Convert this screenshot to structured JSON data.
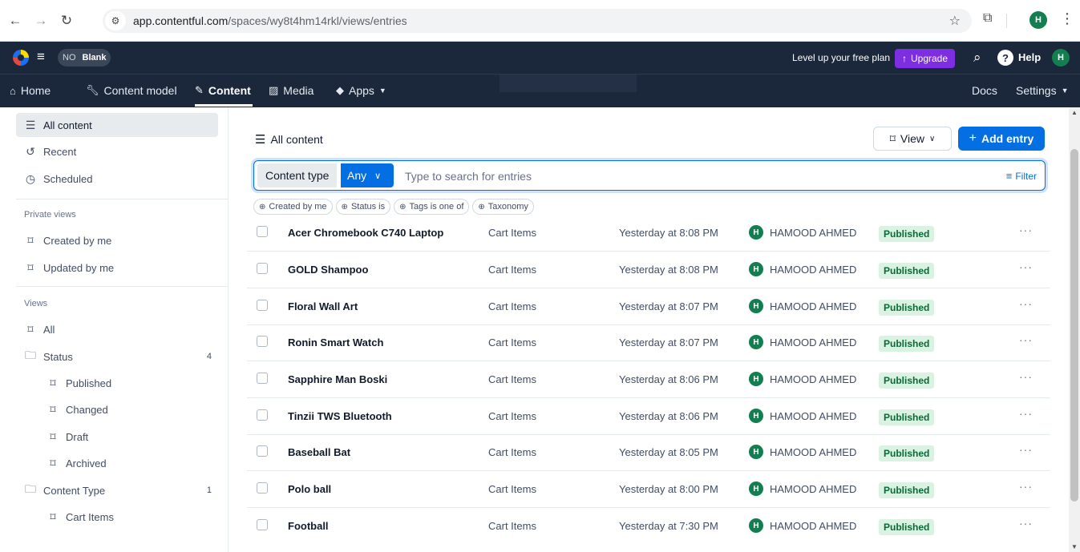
{
  "browser": {
    "url_host": "app.contentful.com",
    "url_path": "/spaces/wy8t4hm14rkl/views/entries",
    "profile_initial": "H"
  },
  "topbar": {
    "org_initials": "NO",
    "space_name": "Blank",
    "level_up": "Level up your free plan",
    "upgrade": "Upgrade",
    "help": "Help",
    "avatar_initial": "H"
  },
  "nav": {
    "home": "Home",
    "content_model": "Content model",
    "content": "Content",
    "media": "Media",
    "apps": "Apps",
    "docs": "Docs",
    "settings": "Settings"
  },
  "sidebar": {
    "all_content": "All content",
    "recent": "Recent",
    "scheduled": "Scheduled",
    "private_views_heading": "Private views",
    "created_by_me": "Created by me",
    "updated_by_me": "Updated by me",
    "views_heading": "Views",
    "all": "All",
    "status": "Status",
    "status_count": "4",
    "published": "Published",
    "changed": "Changed",
    "draft": "Draft",
    "archived": "Archived",
    "content_type": "Content Type",
    "content_type_count": "1",
    "cart_items": "Cart Items"
  },
  "main": {
    "title": "All content",
    "view_button": "View",
    "add_entry": "Add entry",
    "content_type_label": "Content type",
    "content_type_value": "Any",
    "search_placeholder": "Type to search for entries",
    "filter": "Filter",
    "chips": [
      "Created by me",
      "Status is",
      "Tags is one of",
      "Taxonomy"
    ]
  },
  "entries": [
    {
      "name": "Acer Chromebook C740 Laptop",
      "type": "Cart Items",
      "updated": "Yesterday at 8:08 PM",
      "author_initial": "H",
      "author": "HAMOOD AHMED",
      "status": "Published"
    },
    {
      "name": "GOLD Shampoo",
      "type": "Cart Items",
      "updated": "Yesterday at 8:08 PM",
      "author_initial": "H",
      "author": "HAMOOD AHMED",
      "status": "Published"
    },
    {
      "name": "Floral Wall Art",
      "type": "Cart Items",
      "updated": "Yesterday at 8:07 PM",
      "author_initial": "H",
      "author": "HAMOOD AHMED",
      "status": "Published"
    },
    {
      "name": "Ronin Smart Watch",
      "type": "Cart Items",
      "updated": "Yesterday at 8:07 PM",
      "author_initial": "H",
      "author": "HAMOOD AHMED",
      "status": "Published"
    },
    {
      "name": "Sapphire Man Boski",
      "type": "Cart Items",
      "updated": "Yesterday at 8:06 PM",
      "author_initial": "H",
      "author": "HAMOOD AHMED",
      "status": "Published"
    },
    {
      "name": "Tinzii TWS Bluetooth",
      "type": "Cart Items",
      "updated": "Yesterday at 8:06 PM",
      "author_initial": "H",
      "author": "HAMOOD AHMED",
      "status": "Published"
    },
    {
      "name": "Baseball Bat",
      "type": "Cart Items",
      "updated": "Yesterday at 8:05 PM",
      "author_initial": "H",
      "author": "HAMOOD AHMED",
      "status": "Published"
    },
    {
      "name": "Polo ball",
      "type": "Cart Items",
      "updated": "Yesterday at 8:00 PM",
      "author_initial": "H",
      "author": "HAMOOD AHMED",
      "status": "Published"
    },
    {
      "name": "Football",
      "type": "Cart Items",
      "updated": "Yesterday at 7:30 PM",
      "author_initial": "H",
      "author": "HAMOOD AHMED",
      "status": "Published"
    }
  ],
  "colors": {
    "topbar_bg": "#1b273a",
    "primary": "#036fe3",
    "upgrade": "#7d2ee0",
    "published_bg": "#d9f2e2",
    "published_text": "#076b35",
    "avatar": "#137e4f"
  },
  "icons": {
    "back": "arrow-left-icon",
    "forward": "arrow-right-icon",
    "reload": "reload-icon",
    "site_info": "tune-icon",
    "bookmark": "star-icon",
    "extensions": "puzzle-icon",
    "menu": "kebab-icon",
    "logo": "contentful-logo",
    "search": "search-icon",
    "help": "help-icon",
    "bookmark_view": "bookmark-icon",
    "folder": "folder-icon",
    "filter": "filter-icon"
  }
}
